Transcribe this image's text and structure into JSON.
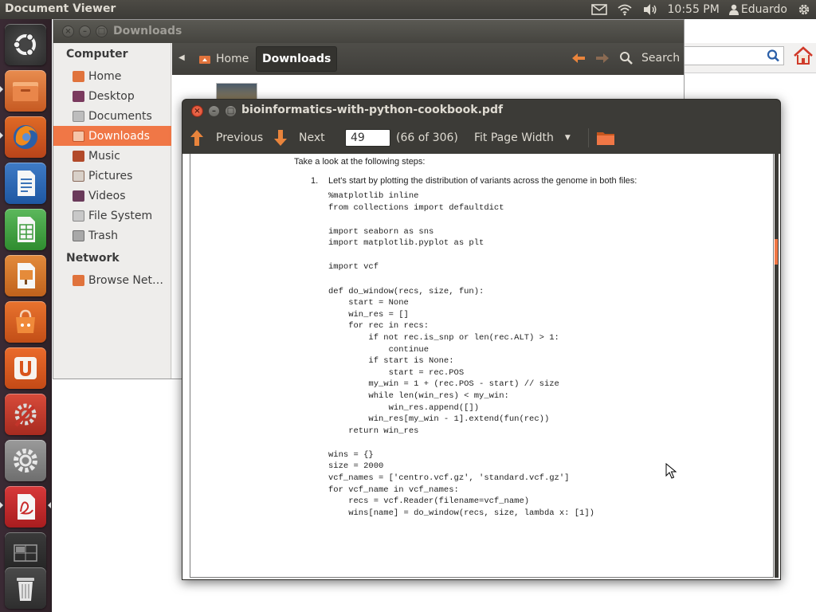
{
  "top_panel": {
    "app_title": "Document Viewer",
    "clock": "10:55 PM",
    "user": "Eduardo",
    "icons": [
      "mail-icon",
      "wifi-icon",
      "volume-icon",
      "user-icon",
      "gear-icon"
    ]
  },
  "launcher": {
    "items": [
      "ubuntu-dash",
      "files",
      "firefox",
      "libreoffice-writer",
      "libreoffice-calc",
      "libreoffice-impress",
      "ubuntu-software-center",
      "ubuntu-one",
      "system-tools",
      "system-settings",
      "document-viewer",
      "workspace-switcher",
      "trash"
    ]
  },
  "files_window": {
    "title": "Downloads",
    "sidebar": {
      "computer_heading": "Computer",
      "items": [
        "Home",
        "Desktop",
        "Documents",
        "Downloads",
        "Music",
        "Pictures",
        "Videos",
        "File System",
        "Trash"
      ],
      "network_heading": "Network",
      "network_items": [
        "Browse Net…"
      ]
    },
    "breadcrumbs": [
      "Home",
      "Downloads"
    ],
    "search_label": "Search"
  },
  "viewer_window": {
    "title": "bioinformatics-with-python-cookbook.pdf",
    "toolbar": {
      "previous_label": "Previous",
      "next_label": "Next",
      "page_value": "49",
      "page_count": "(66 of 306)",
      "zoom_label": "Fit Page Width"
    },
    "page": {
      "intro": "Take a look at the following steps:",
      "step_number": "1.",
      "step_text": "Let's start by plotting the distribution of variants across the genome in both files:",
      "code": [
        "%matplotlib inline",
        "from collections import defaultdict",
        "",
        "import seaborn as sns",
        "import matplotlib.pyplot as plt",
        "",
        "import vcf",
        "",
        "def do_window(recs, size, fun):",
        "    start = None",
        "    win_res = []",
        "    for rec in recs:",
        "        if not rec.is_snp or len(rec.ALT) > 1:",
        "            continue",
        "        if start is None:",
        "            start = rec.POS",
        "        my_win = 1 + (rec.POS - start) // size",
        "        while len(win_res) < my_win:",
        "            win_res.append([])",
        "        win_res[my_win - 1].extend(fun(rec))",
        "    return win_res",
        "",
        "wins = {}",
        "size = 2000",
        "vcf_names = ['centro.vcf.gz', 'standard.vcf.gz']",
        "for vcf_name in vcf_names:",
        "    recs = vcf.Reader(filename=vcf_name)",
        "    wins[name] = do_window(recs, size, lambda x: [1])"
      ]
    }
  },
  "colors": {
    "accent": "#f07746",
    "panel": "#3c3b37",
    "text_light": "#dfdbd2"
  }
}
